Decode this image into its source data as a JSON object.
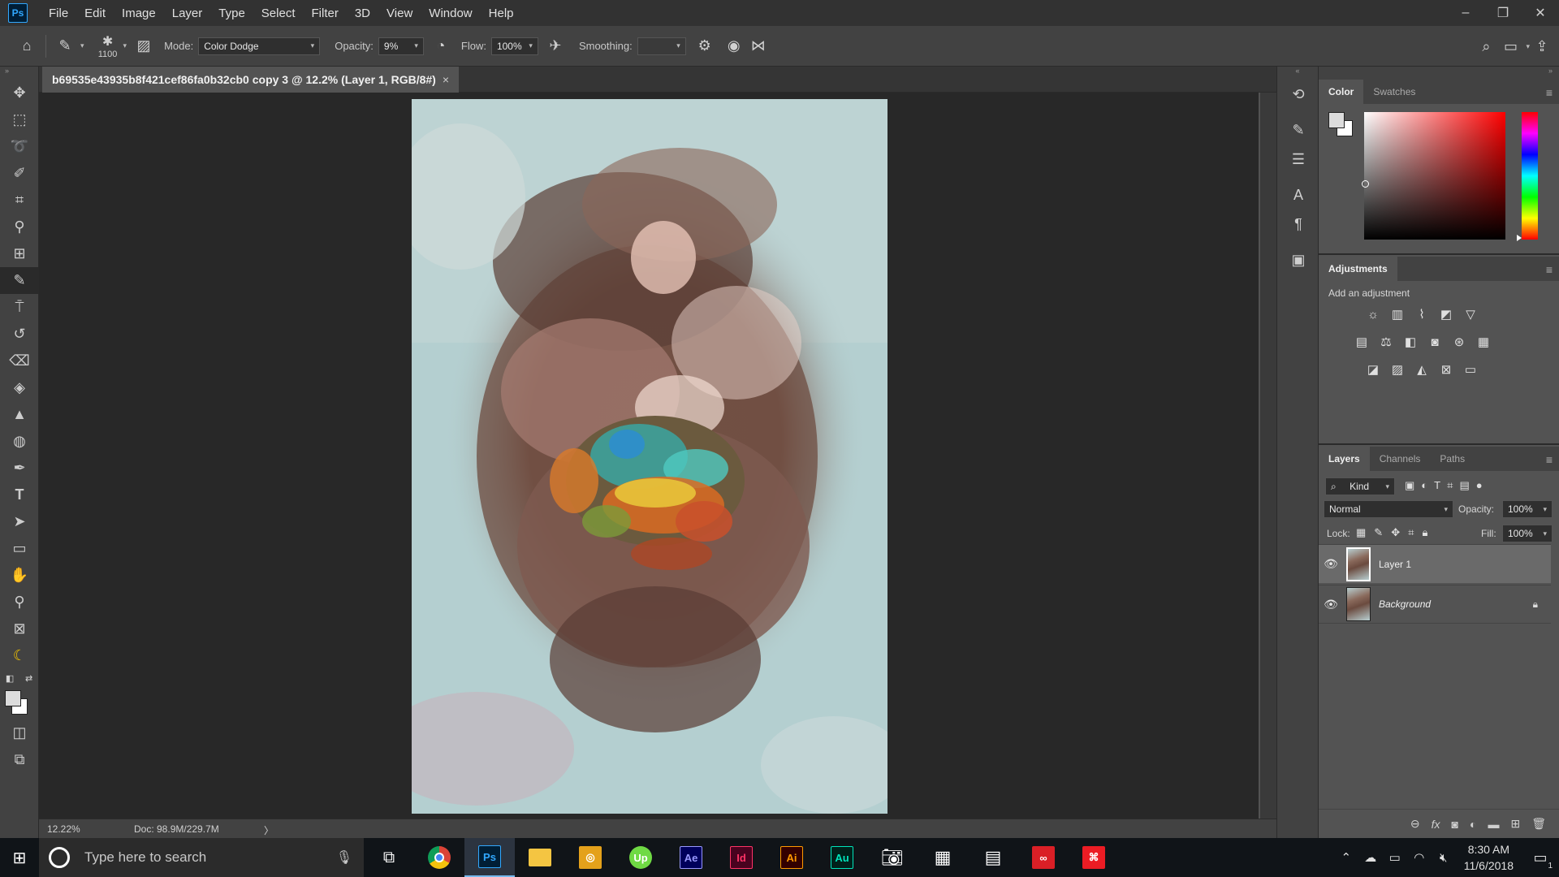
{
  "app": {
    "logo": "Ps"
  },
  "menu": [
    "File",
    "Edit",
    "Image",
    "Layer",
    "Type",
    "Select",
    "Filter",
    "3D",
    "View",
    "Window",
    "Help"
  ],
  "window_controls": {
    "minimize": "–",
    "restore": "❐",
    "close": "✕"
  },
  "options": {
    "brush_size": "1100",
    "mode_label": "Mode:",
    "mode_value": "Color Dodge",
    "opacity_label": "Opacity:",
    "opacity_value": "9%",
    "flow_label": "Flow:",
    "flow_value": "100%",
    "smoothing_label": "Smoothing:",
    "smoothing_value": ""
  },
  "document": {
    "tab_title": "b69535e43935b8f421cef86fa0b32cb0 copy 3 @ 12.2% (Layer 1, RGB/8#)",
    "close": "×"
  },
  "status": {
    "zoom": "12.22%",
    "doc": "Doc: 98.9M/229.7M",
    "arrow": "〉"
  },
  "color_panel": {
    "tabs": [
      "Color",
      "Swatches"
    ]
  },
  "adjustments_panel": {
    "title": "Adjustments",
    "hint": "Add an adjustment"
  },
  "layers_panel": {
    "tabs": [
      "Layers",
      "Channels",
      "Paths"
    ],
    "filter_kind": "Kind",
    "blend_mode": "Normal",
    "opacity_label": "Opacity:",
    "opacity_value": "100%",
    "lock_label": "Lock:",
    "fill_label": "Fill:",
    "fill_value": "100%",
    "layers": [
      {
        "name": "Layer 1",
        "selected": true,
        "locked": false
      },
      {
        "name": "Background",
        "selected": false,
        "locked": true
      }
    ]
  },
  "taskbar": {
    "search_placeholder": "Type here to search",
    "apps": [
      {
        "name": "Chrome",
        "label": "",
        "color": "#4285f4"
      },
      {
        "name": "Photoshop",
        "label": "Ps",
        "color": "#31a8ff"
      },
      {
        "name": "File Explorer",
        "label": "",
        "color": "#f4c542"
      },
      {
        "name": "Instagram",
        "label": "◎",
        "color": "#e4a11b"
      },
      {
        "name": "Upwork",
        "label": "Up",
        "color": "#6fda44"
      },
      {
        "name": "After Effects",
        "label": "Ae",
        "color": "#9999ff"
      },
      {
        "name": "InDesign",
        "label": "Id",
        "color": "#ff3366"
      },
      {
        "name": "Illustrator",
        "label": "Ai",
        "color": "#ff9a00"
      },
      {
        "name": "Audition",
        "label": "Au",
        "color": "#00e4bb"
      },
      {
        "name": "Camera",
        "label": "",
        "color": "#ffffff"
      },
      {
        "name": "Calendar",
        "label": "",
        "color": "#ffffff"
      },
      {
        "name": "Calculator",
        "label": "",
        "color": "#ffffff"
      },
      {
        "name": "Creative Cloud",
        "label": "",
        "color": "#da1f26"
      },
      {
        "name": "Acrobat",
        "label": "",
        "color": "#ec1c24"
      }
    ],
    "time": "8:30 AM",
    "date": "11/6/2018",
    "notifications": "1"
  }
}
